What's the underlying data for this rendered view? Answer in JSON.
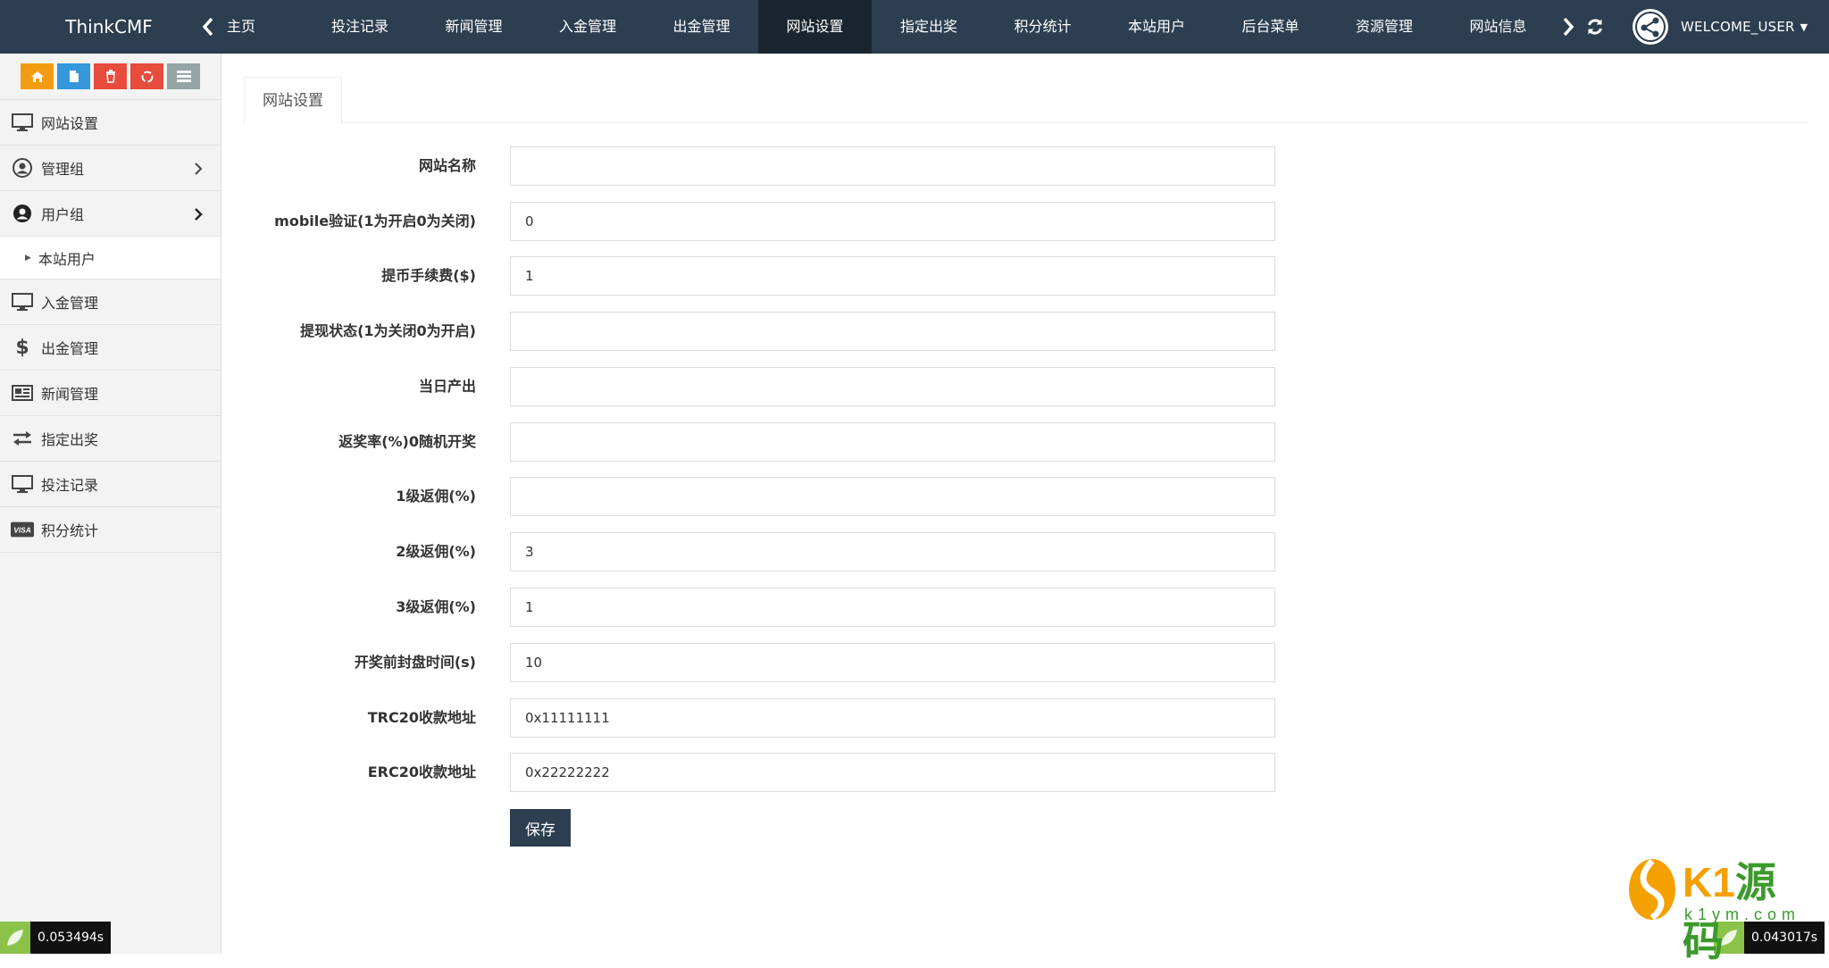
{
  "brand": "ThinkCMF",
  "nav": {
    "items": [
      {
        "label": "主页"
      },
      {
        "label": "投注记录"
      },
      {
        "label": "新闻管理"
      },
      {
        "label": "入金管理"
      },
      {
        "label": "出金管理"
      },
      {
        "label": "网站设置",
        "active": true
      },
      {
        "label": "指定出奖"
      },
      {
        "label": "积分统计"
      },
      {
        "label": "本站用户"
      },
      {
        "label": "后台菜单"
      },
      {
        "label": "资源管理"
      },
      {
        "label": "网站信息"
      }
    ],
    "user": "WELCOME_USER"
  },
  "sidebar": {
    "shortcut_colors": [
      "#f39c12",
      "#3498db",
      "#e74c3c",
      "#e74c3c",
      "#95a5a6"
    ],
    "shortcut_icons": [
      "home-icon",
      "file-icon",
      "trash-icon",
      "recycle-icon",
      "list-icon"
    ],
    "items": [
      {
        "label": "网站设置",
        "icon": "monitor-icon"
      },
      {
        "label": "管理组",
        "icon": "user-circle-icon"
      },
      {
        "label": "用户组",
        "icon": "user-circle-dark-icon"
      },
      {
        "label": "本站用户"
      },
      {
        "label": "入金管理",
        "icon": "monitor-icon"
      },
      {
        "label": "出金管理",
        "icon": "dollar-icon"
      },
      {
        "label": "新闻管理",
        "icon": "newspaper-icon"
      },
      {
        "label": "指定出奖",
        "icon": "exchange-icon"
      },
      {
        "label": "投注记录",
        "icon": "monitor-icon"
      },
      {
        "label": "积分统计",
        "icon": "visa-icon"
      }
    ]
  },
  "main": {
    "tab": "网站设置",
    "fields": [
      {
        "label": "网站名称",
        "value": ""
      },
      {
        "label": "mobile验证(1为开启0为关闭)",
        "value": "0"
      },
      {
        "label": "提币手续费($)",
        "value": "1"
      },
      {
        "label": "提现状态(1为关闭0为开启)",
        "value": ""
      },
      {
        "label": "当日产出",
        "value": ""
      },
      {
        "label": "返奖率(%)0随机开奖",
        "value": ""
      },
      {
        "label": "1级返佣(%)",
        "value": ""
      },
      {
        "label": "2级返佣(%)",
        "value": "3"
      },
      {
        "label": "3级返佣(%)",
        "value": "1"
      },
      {
        "label": "开奖前封盘时间(s)",
        "value": "10"
      },
      {
        "label": "TRC20收款地址",
        "value": "0x11111111"
      },
      {
        "label": "ERC20收款地址",
        "value": "0x22222222"
      }
    ],
    "save_label": "保存"
  },
  "timers": {
    "left": "0.053494s",
    "right": "0.043017s"
  },
  "watermark": {
    "text_latin": "K1",
    "text_cn": "源码",
    "sub": "k1ym.com"
  }
}
